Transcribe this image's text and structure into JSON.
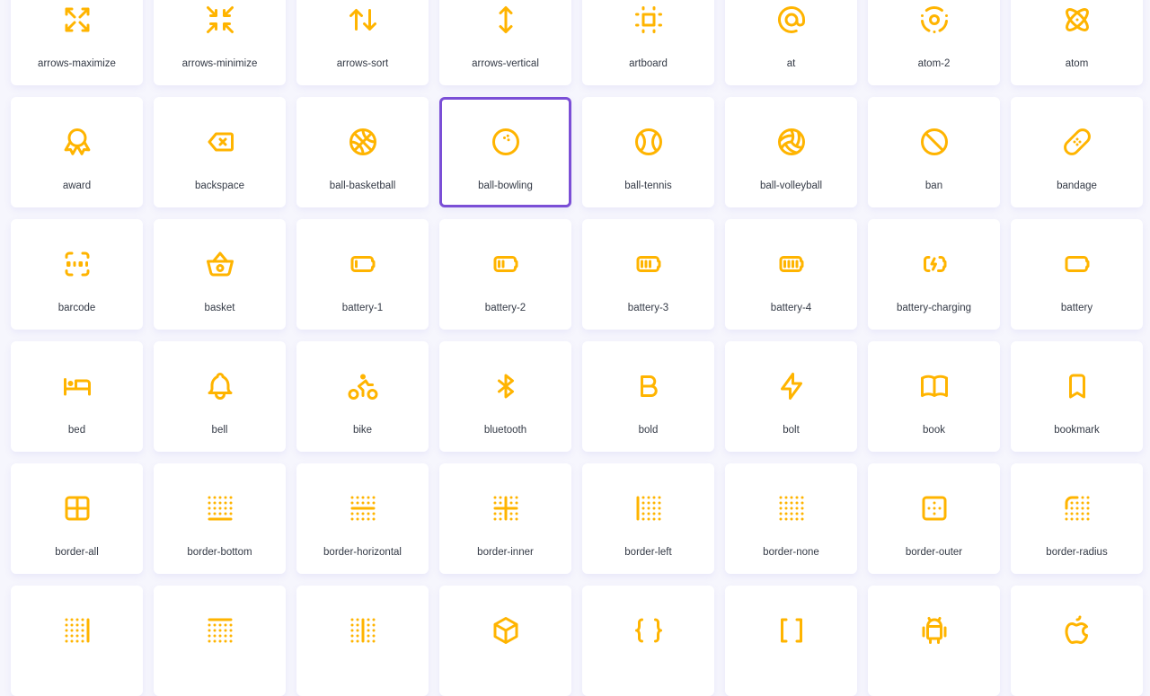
{
  "accent_color": "#ffb400",
  "selection_color": "#7b4fd6",
  "selected_icon": "ball-bowling",
  "icons": [
    {
      "label": "arrows-maximize",
      "icon": "arrows-maximize"
    },
    {
      "label": "arrows-minimize",
      "icon": "arrows-minimize"
    },
    {
      "label": "arrows-sort",
      "icon": "arrows-sort"
    },
    {
      "label": "arrows-vertical",
      "icon": "arrows-vertical"
    },
    {
      "label": "artboard",
      "icon": "artboard"
    },
    {
      "label": "at",
      "icon": "at"
    },
    {
      "label": "atom-2",
      "icon": "atom-2"
    },
    {
      "label": "atom",
      "icon": "atom"
    },
    {
      "label": "award",
      "icon": "award"
    },
    {
      "label": "backspace",
      "icon": "backspace"
    },
    {
      "label": "ball-basketball",
      "icon": "ball-basketball"
    },
    {
      "label": "ball-bowling",
      "icon": "ball-bowling"
    },
    {
      "label": "ball-tennis",
      "icon": "ball-tennis"
    },
    {
      "label": "ball-volleyball",
      "icon": "ball-volleyball"
    },
    {
      "label": "ban",
      "icon": "ban"
    },
    {
      "label": "bandage",
      "icon": "bandage"
    },
    {
      "label": "barcode",
      "icon": "barcode"
    },
    {
      "label": "basket",
      "icon": "basket"
    },
    {
      "label": "battery-1",
      "icon": "battery-1"
    },
    {
      "label": "battery-2",
      "icon": "battery-2"
    },
    {
      "label": "battery-3",
      "icon": "battery-3"
    },
    {
      "label": "battery-4",
      "icon": "battery-4"
    },
    {
      "label": "battery-charging",
      "icon": "battery-charging"
    },
    {
      "label": "battery",
      "icon": "battery"
    },
    {
      "label": "bed",
      "icon": "bed"
    },
    {
      "label": "bell",
      "icon": "bell"
    },
    {
      "label": "bike",
      "icon": "bike"
    },
    {
      "label": "bluetooth",
      "icon": "bluetooth"
    },
    {
      "label": "bold",
      "icon": "bold"
    },
    {
      "label": "bolt",
      "icon": "bolt"
    },
    {
      "label": "book",
      "icon": "book"
    },
    {
      "label": "bookmark",
      "icon": "bookmark"
    },
    {
      "label": "border-all",
      "icon": "border-all"
    },
    {
      "label": "border-bottom",
      "icon": "border-bottom"
    },
    {
      "label": "border-horizontal",
      "icon": "border-horizontal"
    },
    {
      "label": "border-inner",
      "icon": "border-inner"
    },
    {
      "label": "border-left",
      "icon": "border-left"
    },
    {
      "label": "border-none",
      "icon": "border-none"
    },
    {
      "label": "border-outer",
      "icon": "border-outer"
    },
    {
      "label": "border-radius",
      "icon": "border-radius"
    },
    {
      "icon": "border-right"
    },
    {
      "icon": "border-top"
    },
    {
      "icon": "border-vertical"
    },
    {
      "icon": "box"
    },
    {
      "icon": "braces"
    },
    {
      "icon": "brackets"
    },
    {
      "icon": "brand-android"
    },
    {
      "icon": "brand-apple"
    }
  ]
}
